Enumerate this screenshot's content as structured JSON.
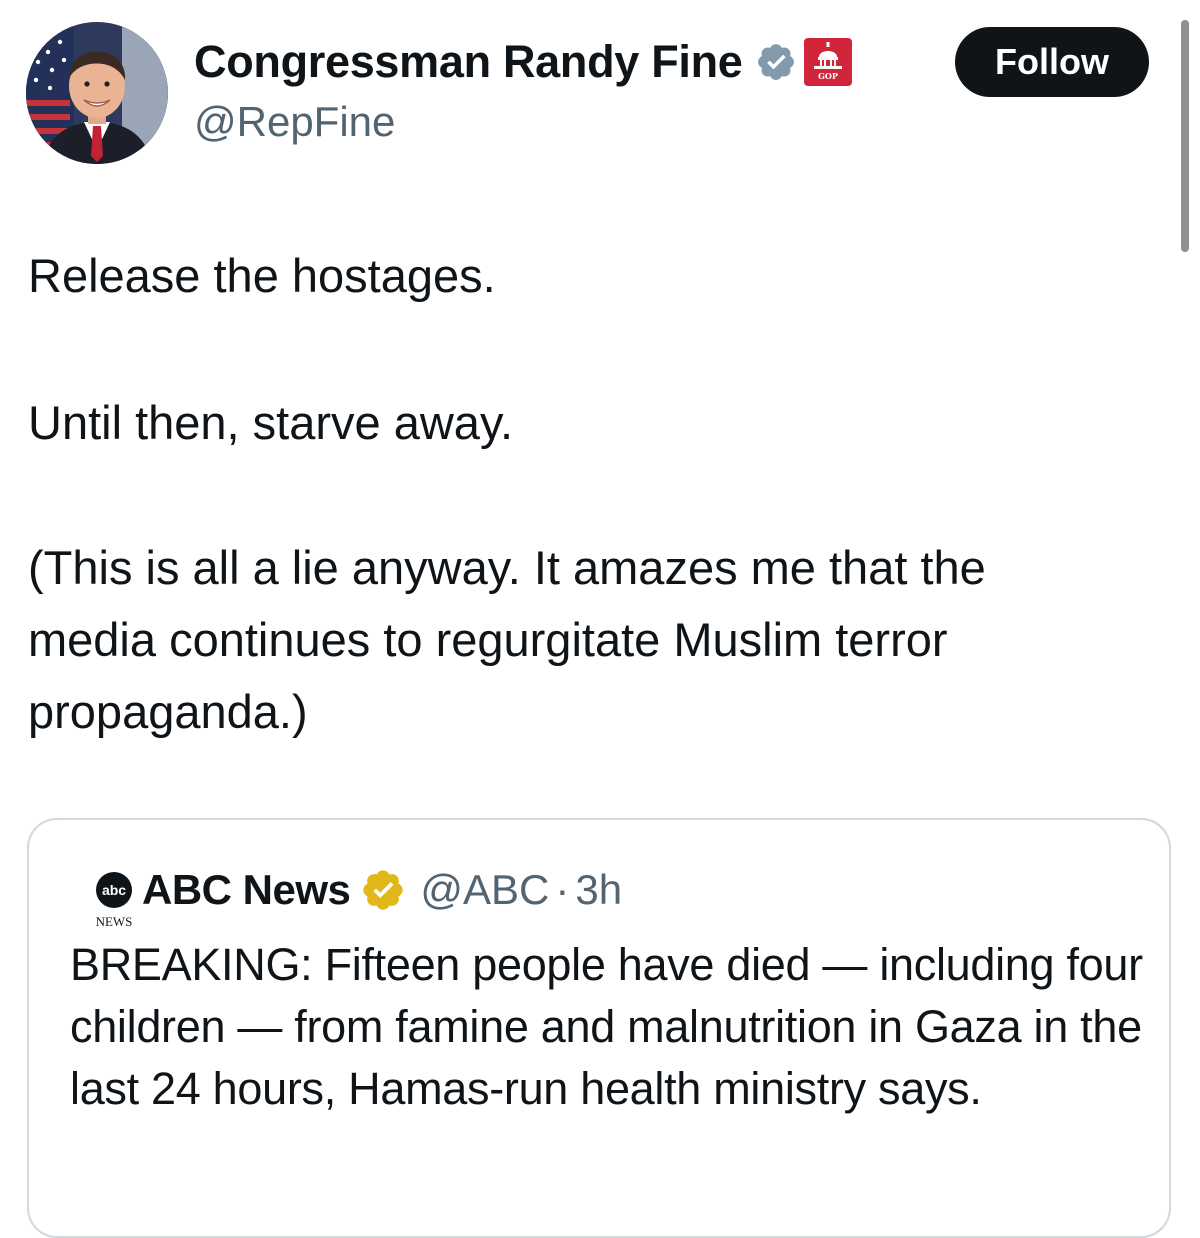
{
  "author": {
    "display_name": "Congressman Randy Fine",
    "handle": "@RepFine",
    "avatar_icon": "avatar-photo",
    "verified_badge_icon": "grey-verified-badge-icon",
    "affiliation_badge_icon": "house-gop-capitol-icon",
    "affiliation_badge_text": "GOP"
  },
  "follow_button": {
    "label": "Follow"
  },
  "tweet": {
    "paragraph_1": "Release the hostages.",
    "paragraph_2": "Until then, starve away.",
    "paragraph_3_line_1": "(This is all a lie anyway.  It amazes me that the",
    "paragraph_3_line_2": "media continues to regurgitate Muslim terror",
    "paragraph_3_line_3": "propaganda.)"
  },
  "quoted_tweet": {
    "logo_icon": "abc-news-logo-icon",
    "logo_text": "abc",
    "logo_subtext": "NEWS",
    "display_name": "ABC News",
    "verified_badge_icon": "gold-verified-badge-icon",
    "handle": "@ABC",
    "separator": "·",
    "time": "3h",
    "text": "BREAKING: Fifteen people have died — including four children — from famine and malnutrition in Gaza in the last 24 hours, Hamas-run health ministry says."
  },
  "colors": {
    "text_primary": "#0f1419",
    "text_secondary": "#536471",
    "follow_bg": "#0f1419",
    "verified_grey": "#829aab",
    "verified_gold": "#e2b719",
    "gop_red": "#d0253a",
    "card_border": "#cfd9de"
  }
}
